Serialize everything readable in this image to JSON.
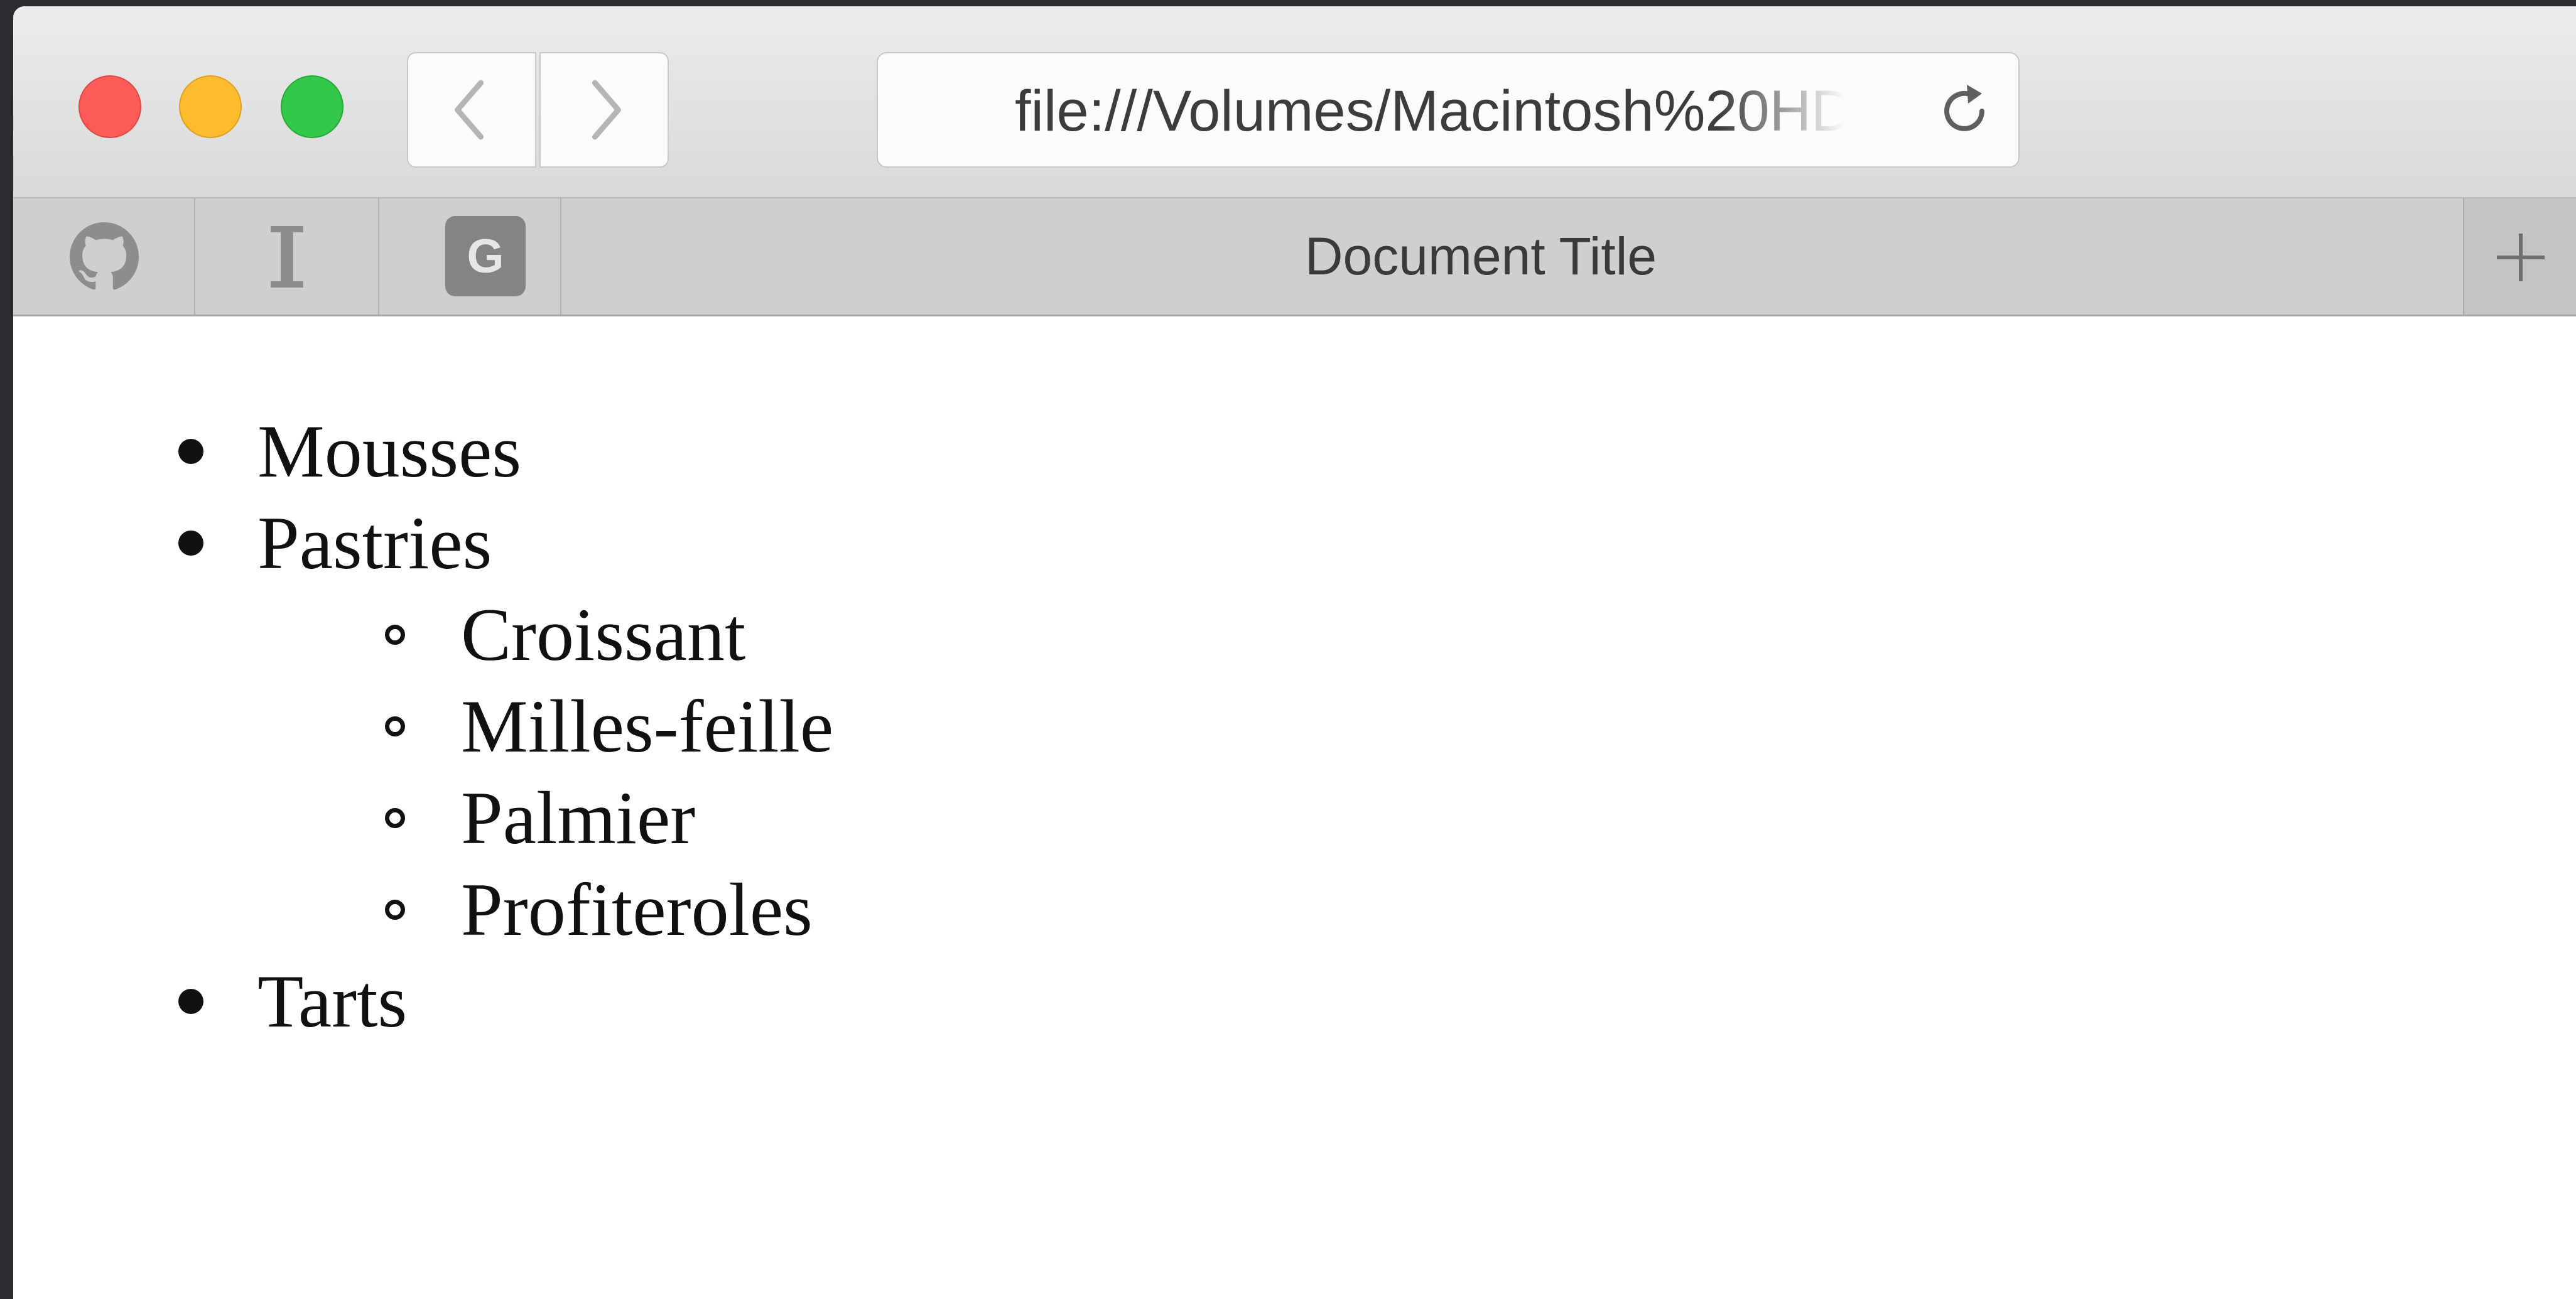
{
  "browser": {
    "url": "file:///Volumes/Macintosh%20HD",
    "tab_title": "Document Title",
    "pinned_tabs": [
      {
        "icon": "github-icon"
      },
      {
        "icon": "instapaper-icon",
        "glyph": "I"
      },
      {
        "icon": "google-icon",
        "glyph": "G"
      }
    ],
    "new_tab_icon": "plus-icon",
    "traffic_lights": {
      "close": "#fc5b57",
      "minimize": "#fdbc2e",
      "maximize": "#34c84a"
    }
  },
  "document": {
    "list": [
      {
        "label": "Mousses"
      },
      {
        "label": "Pastries",
        "children": [
          "Croissant",
          "Milles-feille",
          "Palmier",
          "Profiteroles"
        ]
      },
      {
        "label": "Tarts"
      }
    ]
  }
}
